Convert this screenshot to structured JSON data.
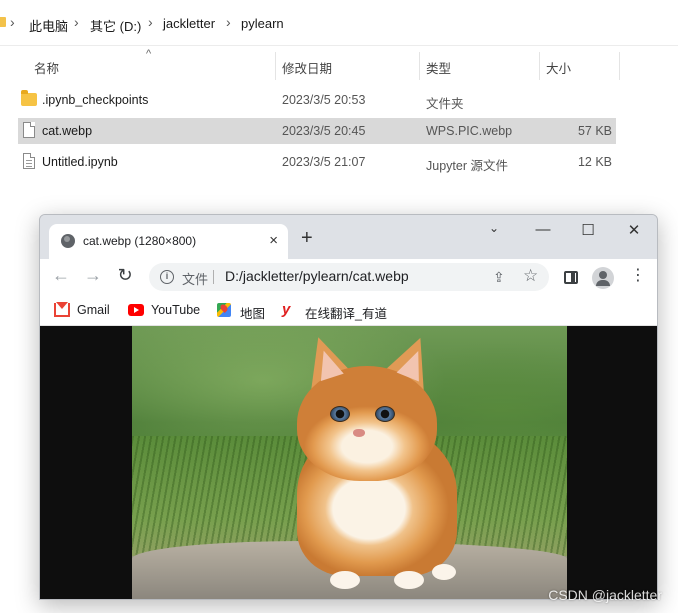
{
  "breadcrumb": {
    "items": [
      "此电脑",
      "其它 (D:)",
      "jackletter",
      "pylearn"
    ],
    "separator": "›"
  },
  "columns": {
    "name": "名称",
    "date": "修改日期",
    "type": "类型",
    "size": "大小"
  },
  "files": [
    {
      "name": ".ipynb_checkpoints",
      "date": "2023/3/5 20:53",
      "type": "文件夹",
      "size": "",
      "icon": "folder-icon",
      "selected": false
    },
    {
      "name": "cat.webp",
      "date": "2023/3/5 20:45",
      "type": "WPS.PIC.webp",
      "size": "57 KB",
      "icon": "document-icon",
      "selected": true
    },
    {
      "name": "Untitled.ipynb",
      "date": "2023/3/5 21:07",
      "type": "Jupyter 源文件",
      "size": "12 KB",
      "icon": "document-icon",
      "selected": false
    }
  ],
  "browser": {
    "tab_title": "cat.webp (1280×800)",
    "tab_close": "×",
    "new_tab": "+",
    "window_controls": {
      "tab_search": "⌄",
      "minimize": "—",
      "maximize": "☐",
      "close": "✕"
    },
    "nav": {
      "back": "←",
      "forward": "→",
      "reload": "↻"
    },
    "omnibox": {
      "label": "文件",
      "url": "D:/jackletter/pylearn/cat.webp"
    },
    "bookmarks": [
      {
        "label": "Gmail",
        "icon": "gmail-icon"
      },
      {
        "label": "YouTube",
        "icon": "youtube-icon"
      },
      {
        "label": "地图",
        "icon": "maps-icon"
      },
      {
        "label": "在线翻译_有道",
        "icon": "youdao-icon",
        "glyph": "y"
      }
    ],
    "image_alt": "orange kitten on a rock"
  },
  "watermark": "CSDN @jackletter",
  "colors": {
    "selection": "#d9d9d9",
    "folder": "#f6c344",
    "tab_strip": "#dee1e6",
    "viewer_bg": "#0e0e0e"
  }
}
